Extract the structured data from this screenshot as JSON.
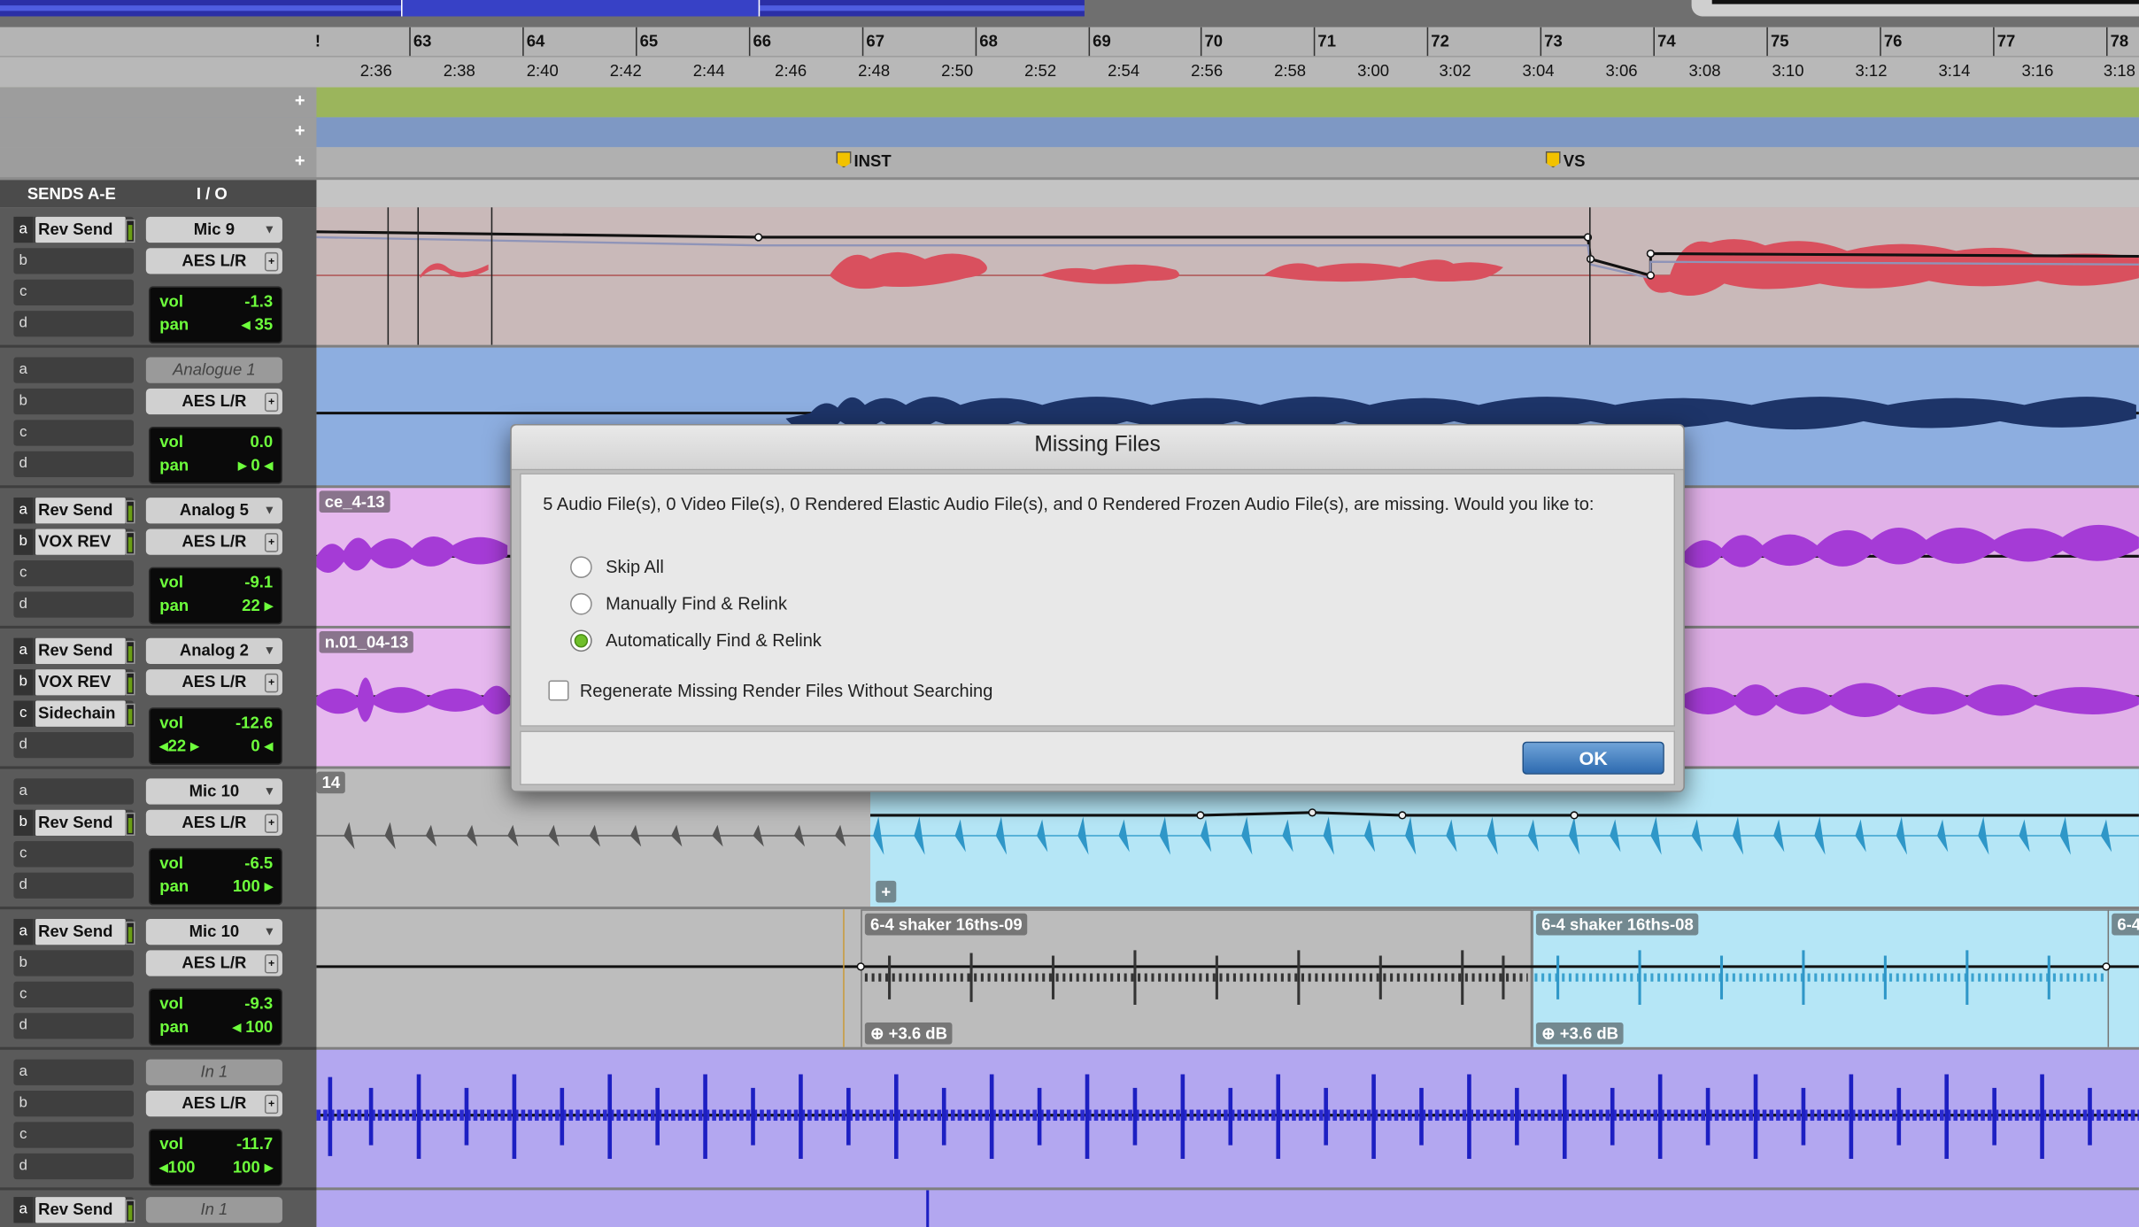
{
  "bars": [
    "!",
    "63",
    "64",
    "65",
    "66",
    "67",
    "68",
    "69",
    "70",
    "71",
    "72",
    "73",
    "74",
    "75",
    "76",
    "77",
    "78"
  ],
  "times": [
    "2:36",
    "2:38",
    "2:40",
    "2:42",
    "2:44",
    "2:46",
    "2:48",
    "2:50",
    "2:52",
    "2:54",
    "2:56",
    "2:58",
    "3:00",
    "3:02",
    "3:04",
    "3:06",
    "3:08",
    "3:10",
    "3:12",
    "3:14",
    "3:16",
    "3:18"
  ],
  "markers": {
    "inst": "INST",
    "vs": "VS"
  },
  "lanes": {
    "plus": "+"
  },
  "headers": {
    "sends": "SENDS A-E",
    "io": "I / O"
  },
  "tracks": [
    {
      "sends": [
        "Rev Send",
        "",
        "",
        ""
      ],
      "in": "Mic 9",
      "out": "AES L/R",
      "vol": "-1.3",
      "pan": "35",
      "panDir": "left"
    },
    {
      "sends": [
        "",
        "",
        "",
        ""
      ],
      "in": "Analogue 1",
      "out": "AES L/R",
      "vol": "0.0",
      "pan": "0"
    },
    {
      "sends": [
        "Rev Send",
        "VOX REV",
        "",
        ""
      ],
      "in": "Analog 5",
      "out": "AES L/R",
      "vol": "-9.1",
      "pan": "22"
    },
    {
      "sends": [
        "Rev Send",
        "VOX REV",
        "Sidechain",
        ""
      ],
      "in": "Analog 2",
      "out": "AES L/R",
      "vol": "-12.6",
      "panL": "22",
      "panR": "0"
    },
    {
      "sends": [
        "",
        "Rev Send",
        "",
        ""
      ],
      "in": "Mic 10",
      "out": "AES L/R",
      "vol": "-6.5",
      "pan": "100"
    },
    {
      "sends": [
        "Rev Send",
        "",
        "",
        ""
      ],
      "in": "Mic 10",
      "out": "AES L/R",
      "vol": "-9.3",
      "pan": "100"
    },
    {
      "sends": [
        "",
        "",
        "",
        ""
      ],
      "in": "In 1",
      "out": "AES L/R",
      "vol": "-11.7",
      "panL": "100",
      "panR": "100"
    },
    {
      "sends": [
        "Rev Send"
      ],
      "in": "In 1"
    }
  ],
  "letters": [
    "a",
    "b",
    "c",
    "d"
  ],
  "labels": {
    "vol": "vol",
    "pan": "pan"
  },
  "clips": {
    "c1": "ce_4-13",
    "c2": "n.01_04-13",
    "c3": "14",
    "c4": "6-4 shaker 16ths-09",
    "c5": "6-4 shaker 16ths-08",
    "c6": "6-4",
    "g1": "+3.6 dB",
    "g2": "+3.6 dB"
  },
  "dialog": {
    "title": "Missing Files",
    "message": "5 Audio File(s), 0 Video File(s), 0 Rendered Elastic Audio File(s), and 0 Rendered Frozen Audio File(s), are missing. Would you like to:",
    "options": [
      "Skip All",
      "Manually Find & Relink",
      "Automatically Find & Relink"
    ],
    "selected": 2,
    "checkbox": "Regenerate Missing Render Files Without Searching",
    "ok": "OK"
  },
  "colors": {
    "accent_green": "#6fbf2a",
    "ok_blue": "#2e6bb0"
  }
}
